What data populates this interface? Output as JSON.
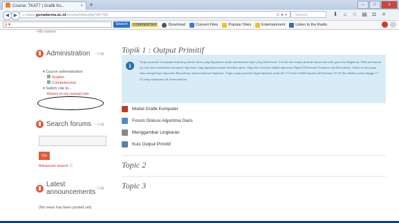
{
  "browser": {
    "tab_title": "Course: TKAT7 | Grafik Ko...",
    "tab_close": "×",
    "new_tab": "+",
    "url_prefix": "v-class.",
    "url_domain": "gunadarma.ac.id",
    "url_path": "/course/view.php?id=796",
    "url_controls": "C  ★ ▾",
    "search_placeholder": "Search",
    "window_minimize": "–",
    "window_maximize": "□",
    "window_close": "x"
  },
  "toolbar": {
    "search_button": "Search",
    "brand": "CONVERTER",
    "download": "Download",
    "convert_files": "Convert Files",
    "popular_sites": "Popular Sites",
    "entertainment": "Entertainment",
    "listen_radio": "Listen to the Radio"
  },
  "left": {
    "top_link": "• My courses",
    "admin_title": "Administration",
    "course_admin": "▾ Course administration",
    "grades": "Grades",
    "competencies": "Competencies",
    "switch_role": "▾ Switch role to...",
    "return_role": "Return to my normal role",
    "search_forums_title": "Search forums",
    "go": "Go",
    "advanced_search": "Advanced search",
    "latest_title": "Latest announcements",
    "no_news": "(No news has been posted yet)"
  },
  "main": {
    "topic1_title": "Topik 1 : Output Primitif",
    "info_text": "Output primitif merupakan bentuk geometri dasar yang digunakan untuk membentuk objek yang lebih besar. Contoh dari output primitif antara lain titik, garis dan lingkaran. Pada pertemuan ini, kita akan membahas mengenai algoritma yang digunakan untuk membuat garis. Algoritma tersebut adalah algoritma Digital Differential Analyzer dan Bresenham. Selain itu kita juga akan mempelajari algoritma Bresenham untuk membuat lingkaran. Tugas output primitif dapat dipelajari pada file V-ClassGrafikKomputer.pdf halaman 25-30 dan dibahas pada minggu 17-23 yang selanjutnya di forum diskusi.",
    "activities": [
      {
        "label": "Modul Grafik Komputer",
        "icon": "file-icon",
        "color": "#c0392b"
      },
      {
        "label": "Forum Diskusi Algoritma Garis",
        "icon": "forum-icon",
        "color": "#4f8cc9"
      },
      {
        "label": "Menggambar Lingkaran",
        "icon": "assignment-icon",
        "color": "#7f8c8d"
      },
      {
        "label": "Kuis Output Primitif",
        "icon": "quiz-icon",
        "color": "#5b7fa8"
      }
    ],
    "topic2_title": "Topic 2",
    "topic3_title": "Topic 3"
  }
}
